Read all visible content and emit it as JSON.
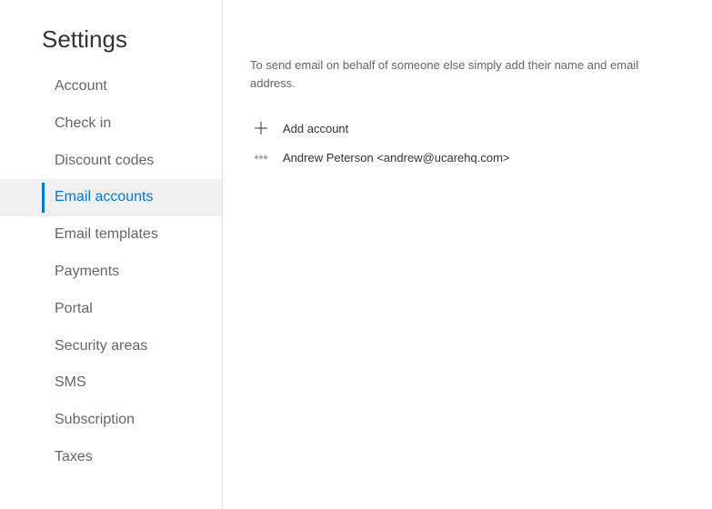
{
  "page": {
    "title": "Settings"
  },
  "sidebar": {
    "items": [
      {
        "label": "Account",
        "id": "account"
      },
      {
        "label": "Check in",
        "id": "check-in"
      },
      {
        "label": "Discount codes",
        "id": "discount-codes"
      },
      {
        "label": "Email accounts",
        "id": "email-accounts",
        "active": true
      },
      {
        "label": "Email templates",
        "id": "email-templates"
      },
      {
        "label": "Payments",
        "id": "payments"
      },
      {
        "label": "Portal",
        "id": "portal"
      },
      {
        "label": "Security areas",
        "id": "security-areas"
      },
      {
        "label": "SMS",
        "id": "sms"
      },
      {
        "label": "Subscription",
        "id": "subscription"
      },
      {
        "label": "Taxes",
        "id": "taxes"
      }
    ]
  },
  "main": {
    "description": "To send email on behalf of someone else simply add their name and email address.",
    "add_label": "Add account",
    "accounts": [
      {
        "display": "Andrew Peterson <andrew@ucarehq.com>"
      }
    ]
  }
}
